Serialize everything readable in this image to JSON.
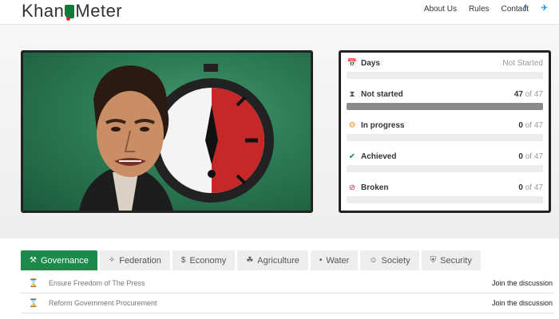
{
  "nav": {
    "logo_left": "Khan",
    "logo_right": "Meter",
    "links": [
      "About Us",
      "Rules",
      "Contact"
    ],
    "social": [
      {
        "name": "facebook-icon",
        "glyph": "f"
      },
      {
        "name": "twitter-icon",
        "glyph": "✈"
      }
    ]
  },
  "stats": {
    "days": {
      "label": "Days",
      "value": "Not Started"
    },
    "rows": [
      {
        "name": "not-started",
        "icon": "⧗",
        "icon_color": "#555",
        "label": "Not started",
        "count": "47",
        "of": "of 47",
        "fraction": 1.0
      },
      {
        "name": "in-progress",
        "icon": "⚙",
        "icon_color": "#f0932b",
        "label": "In progress",
        "count": "0",
        "of": "of 47",
        "fraction": 0
      },
      {
        "name": "achieved",
        "icon": "✔",
        "icon_color": "#1c8a4a",
        "label": "Achieved",
        "count": "0",
        "of": "of 47",
        "fraction": 0
      },
      {
        "name": "broken",
        "icon": "⊘",
        "icon_color": "#d62828",
        "label": "Broken",
        "count": "0",
        "of": "of 47",
        "fraction": 0
      }
    ]
  },
  "tabs": [
    {
      "name": "governance",
      "icon": "⚒",
      "label": "Governance",
      "active": true
    },
    {
      "name": "federation",
      "icon": "✧",
      "label": "Federation",
      "active": false
    },
    {
      "name": "economy",
      "icon": "$",
      "label": "Economy",
      "active": false
    },
    {
      "name": "agriculture",
      "icon": "☘",
      "label": "Agriculture",
      "active": false
    },
    {
      "name": "water",
      "icon": "•",
      "label": "Water",
      "active": false
    },
    {
      "name": "society",
      "icon": "☺",
      "label": "Society",
      "active": false
    },
    {
      "name": "security",
      "icon": "⛨",
      "label": "Security",
      "active": false
    }
  ],
  "promises": [
    {
      "title": "Ensure Freedom of The Press",
      "link": "Join the discussion"
    },
    {
      "title": "Reform Government Procurement",
      "link": "Join the discussion"
    }
  ]
}
